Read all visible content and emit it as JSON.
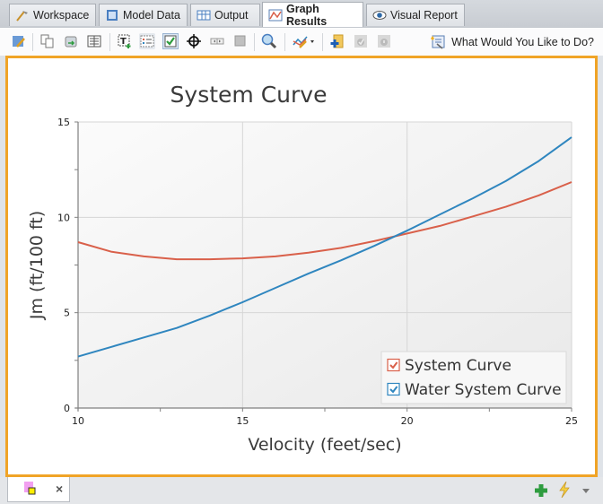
{
  "tabs": [
    {
      "label": "Workspace",
      "icon": "workspace-icon",
      "active": false
    },
    {
      "label": "Model Data",
      "icon": "model-data-icon",
      "active": false
    },
    {
      "label": "Output",
      "icon": "output-table-icon",
      "active": false
    },
    {
      "label": "Graph Results",
      "icon": "graph-icon",
      "active": true
    },
    {
      "label": "Visual Report",
      "icon": "eye-icon",
      "active": false
    }
  ],
  "toolbar": {
    "buttons": [
      "edit-graph-icon",
      "copy-icon",
      "export-icon",
      "table-icon",
      "add-text-icon",
      "legend-icon",
      "checkbox-icon",
      "crosshair-icon",
      "slider-icon",
      "square-icon",
      "zoom-icon",
      "graph-style-icon",
      "add-graph-icon",
      "disabled-check-icon",
      "disabled-info-icon"
    ],
    "help_label": "What Would You Like to Do?"
  },
  "bottom": {
    "close_label": "×"
  },
  "colors": {
    "frame_accent": "#f0a427",
    "system_curve": "#d9604a",
    "water_system_curve": "#2f86bf"
  },
  "chart_data": {
    "type": "line",
    "title": "System Curve",
    "xlabel": "Velocity (feet/sec)",
    "ylabel": "Jm (ft/100 ft)",
    "xlim": [
      10,
      25
    ],
    "ylim": [
      0,
      15
    ],
    "xticks": [
      10,
      15,
      20,
      25
    ],
    "yticks": [
      0,
      5,
      10,
      15
    ],
    "grid": true,
    "legend": "bottom-right",
    "x": [
      10,
      11,
      12,
      13,
      14,
      15,
      16,
      17,
      18,
      19,
      20,
      21,
      22,
      23,
      24,
      25
    ],
    "series": [
      {
        "name": "System Curve",
        "color": "#d9604a",
        "values": [
          8.7,
          8.2,
          7.95,
          7.8,
          7.8,
          7.85,
          7.95,
          8.15,
          8.4,
          8.75,
          9.15,
          9.55,
          10.05,
          10.55,
          11.15,
          11.85
        ]
      },
      {
        "name": "Water System Curve",
        "color": "#2f86bf",
        "values": [
          2.7,
          3.2,
          3.7,
          4.2,
          4.85,
          5.55,
          6.3,
          7.05,
          7.75,
          8.5,
          9.3,
          10.15,
          11.0,
          11.9,
          12.95,
          14.2
        ]
      }
    ]
  }
}
